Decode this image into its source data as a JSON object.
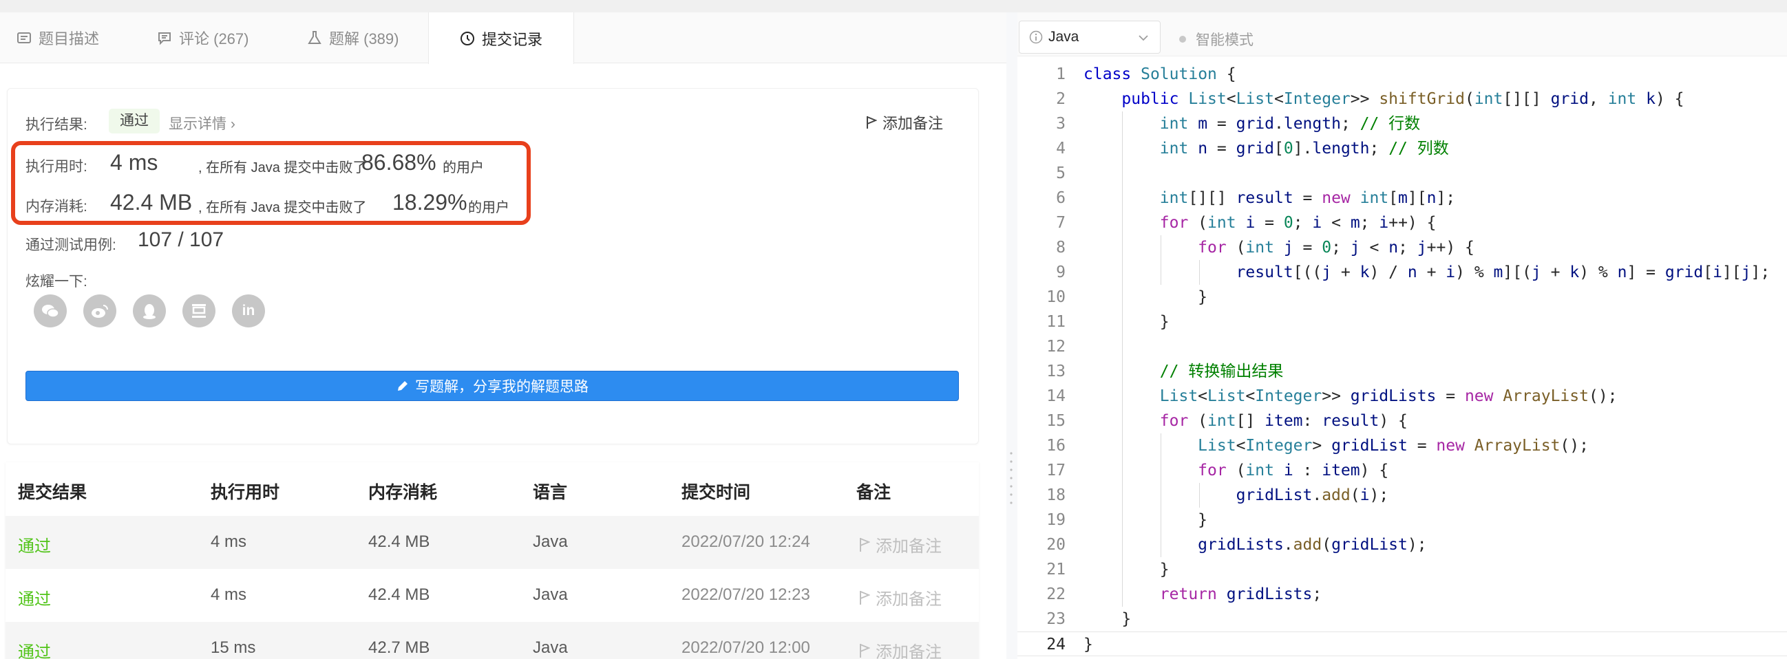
{
  "tabs": [
    {
      "label": "题目描述",
      "icon": "description-icon"
    },
    {
      "label": "评论 (267)",
      "icon": "comment-icon"
    },
    {
      "label": "题解 (389)",
      "icon": "flask-icon"
    },
    {
      "label": "提交记录",
      "icon": "clock-icon"
    }
  ],
  "result": {
    "label": "执行结果:",
    "status": "通过",
    "detail_link": "显示详情 ›",
    "add_note": "添加备注",
    "runtime_label": "执行用时:",
    "runtime_value": "4 ms",
    "runtime_text": ", 在所有 Java 提交中击败了",
    "runtime_percent": "86.68%",
    "runtime_suffix": "的用户",
    "memory_label": "内存消耗:",
    "memory_value": "42.4 MB",
    "memory_text": ", 在所有 Java 提交中击败了",
    "memory_percent": "18.29%",
    "memory_suffix": "的用户",
    "tests_label": "通过测试用例:",
    "tests_value": "107 / 107",
    "share_label": "炫耀一下:",
    "share_icons": [
      "wechat-icon",
      "weibo-icon",
      "qq-icon",
      "douban-icon",
      "linkedin-icon"
    ],
    "write_button": "写题解，分享我的解题思路"
  },
  "table": {
    "headers": [
      "提交结果",
      "执行用时",
      "内存消耗",
      "语言",
      "提交时间",
      "备注"
    ],
    "rows": [
      {
        "status": "通过",
        "runtime": "4 ms",
        "memory": "42.4 MB",
        "lang": "Java",
        "time": "2022/07/20 12:24",
        "note": "添加备注"
      },
      {
        "status": "通过",
        "runtime": "4 ms",
        "memory": "42.4 MB",
        "lang": "Java",
        "time": "2022/07/20 12:23",
        "note": "添加备注"
      },
      {
        "status": "通过",
        "runtime": "15 ms",
        "memory": "42.7 MB",
        "lang": "Java",
        "time": "2022/07/20 12:00",
        "note": "添加备注"
      }
    ]
  },
  "editor": {
    "language": "Java",
    "smart_mode": "智能模式",
    "line_numbers": [
      "1",
      "2",
      "3",
      "4",
      "5",
      "6",
      "7",
      "8",
      "9",
      "10",
      "11",
      "12",
      "13",
      "14",
      "15",
      "16",
      "17",
      "18",
      "19",
      "20",
      "21",
      "22",
      "23",
      "24"
    ]
  },
  "colors": {
    "accent": "#2d8cf0",
    "pass": "#52c41a",
    "highlight": "#e8401c"
  }
}
